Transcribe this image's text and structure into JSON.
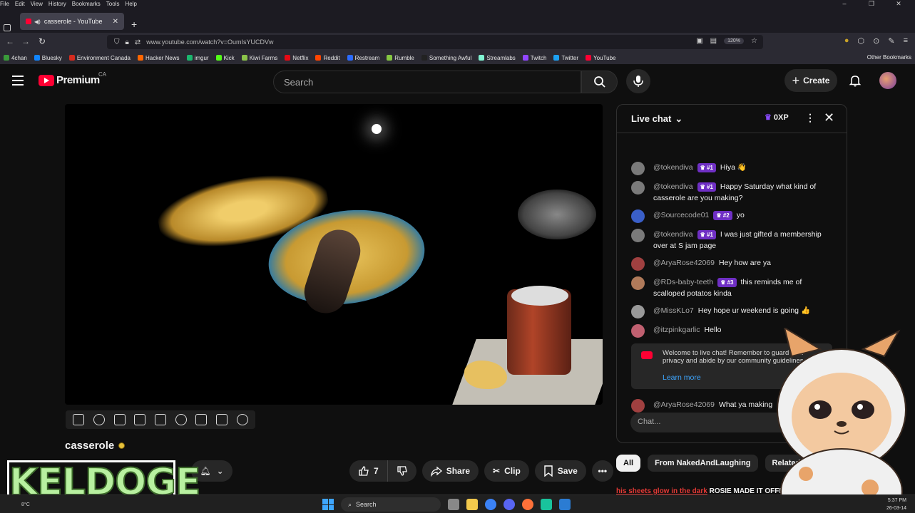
{
  "browser": {
    "menus": [
      "File",
      "Edit",
      "View",
      "History",
      "Bookmarks",
      "Tools",
      "Help"
    ],
    "tab_title": "casserole - YouTube",
    "url": "www.youtube.com/watch?v=OumIsYUCDVw",
    "zoom": "120%",
    "bookmarks": [
      {
        "label": "4chan",
        "color": "#3a9a3a"
      },
      {
        "label": "Bluesky",
        "color": "#1185fe"
      },
      {
        "label": "Environment Canada",
        "color": "#d52b1e"
      },
      {
        "label": "Hacker News",
        "color": "#ff6600"
      },
      {
        "label": "imgur",
        "color": "#1bb76e"
      },
      {
        "label": "Kick",
        "color": "#53fc18"
      },
      {
        "label": "Kiwi Farms",
        "color": "#8bc34a"
      },
      {
        "label": "Netflix",
        "color": "#e50914"
      },
      {
        "label": "Reddit",
        "color": "#ff4500"
      },
      {
        "label": "Restream",
        "color": "#2b6bff"
      },
      {
        "label": "Rumble",
        "color": "#85c742"
      },
      {
        "label": "Something Awful",
        "color": "#222222"
      },
      {
        "label": "Streamlabs",
        "color": "#80f5d2"
      },
      {
        "label": "Twitch",
        "color": "#9146ff"
      },
      {
        "label": "Twitter",
        "color": "#1da1f2"
      },
      {
        "label": "YouTube",
        "color": "#ff0033"
      }
    ],
    "other_bookmarks": "Other Bookmarks"
  },
  "header": {
    "brand": "Premium",
    "region": "CA",
    "search_placeholder": "Search",
    "create_label": "Create"
  },
  "video": {
    "title": "casserole",
    "likes": "7",
    "share_label": "Share",
    "clip_label": "Clip",
    "save_label": "Save"
  },
  "chat": {
    "title": "Live chat",
    "xp": "0XP",
    "messages": [
      {
        "author": "@tokendiva",
        "badge": "#1",
        "text": "Hiya 👋",
        "color": "#7a7a7a"
      },
      {
        "author": "@tokendiva",
        "badge": "#1",
        "text": "Happy Saturday what kind of casserole are you making?",
        "color": "#7a7a7a"
      },
      {
        "author": "@Sourcecode01",
        "badge": "#2",
        "text": "yo",
        "color": "#3a5fc8"
      },
      {
        "author": "@tokendiva",
        "badge": "#1",
        "text": "I was just gifted a membership over at S jam page",
        "color": "#7a7a7a"
      },
      {
        "author": "@AryaRose42069",
        "badge": "",
        "text": "Hey how are ya",
        "color": "#a04040"
      },
      {
        "author": "@RDs-baby-teeth",
        "badge": "#3",
        "text": "this reminds me of scalloped potatos kinda",
        "color": "#b07a5a"
      },
      {
        "author": "@MissKLo7",
        "badge": "",
        "text": "Hey hope ur weekend is going 👍",
        "color": "#999999"
      },
      {
        "author": "@itzpinkgarlic",
        "badge": "",
        "text": "Hello",
        "color": "#c06070"
      }
    ],
    "welcome_text": "Welcome to live chat! Remember to guard your privacy and abide by our community guidelines.",
    "learn_more": "Learn more",
    "last_message": {
      "author": "@AryaRose42069",
      "text": "What ya making",
      "color": "#a04040"
    },
    "input_placeholder": "Chat..."
  },
  "chips": [
    "All",
    "From NakedAndLaughing",
    "Related"
  ],
  "ticker": {
    "red": "his sheets glow in the dark",
    "rest": "ROSIE MADE IT OFFICIAL"
  },
  "overlay": {
    "streamer": "KELDOGE"
  },
  "taskbar": {
    "weather": "8°C",
    "search": "Search",
    "time": "5:37 PM",
    "date": "26-03-14"
  }
}
